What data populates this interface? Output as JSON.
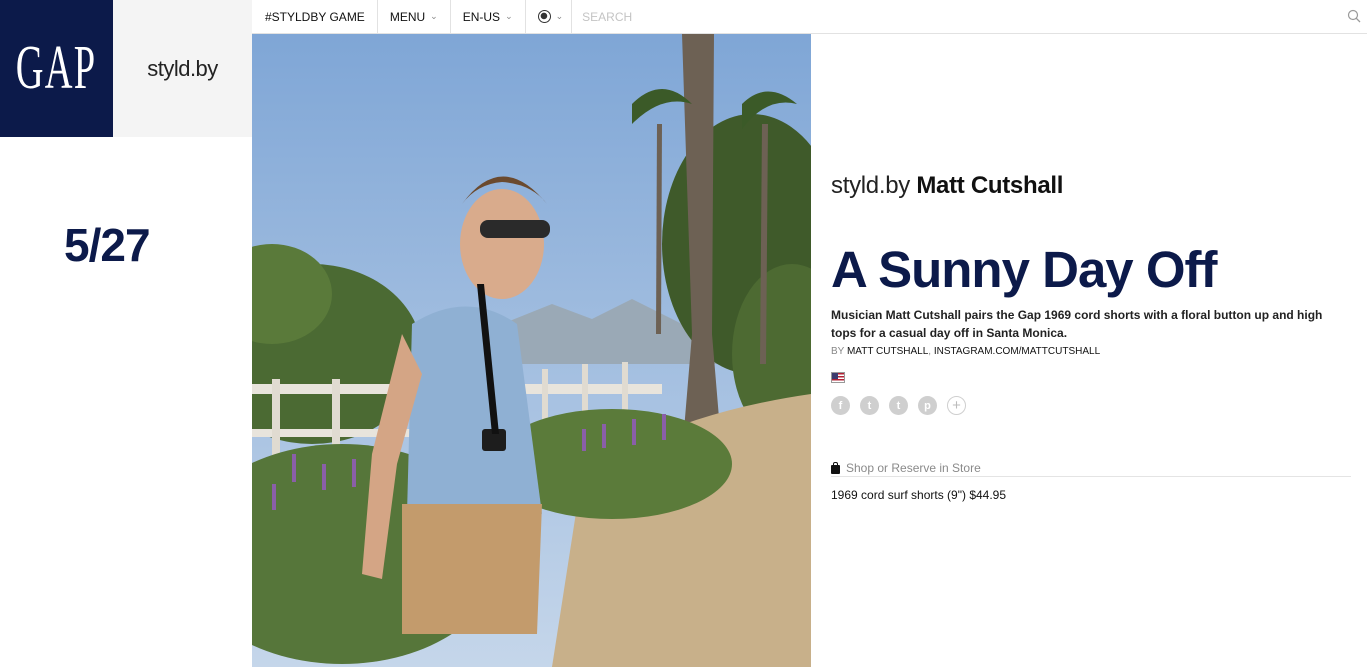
{
  "brand": {
    "logo_text": "GAP",
    "site_name": "styld.by",
    "logo_bg_color": "#0c1a4a"
  },
  "date": "5/27",
  "nav": {
    "game_label": "#STYLDBY GAME",
    "menu_label": "MENU",
    "locale_label": "EN-US",
    "globe_icon": "globe-icon",
    "search_placeholder": "SEARCH",
    "search_icon": "search-icon"
  },
  "article": {
    "byline_prefix": "styld.by",
    "byline_name": "Matt Cutshall",
    "headline": "A Sunny Day Off",
    "description": "Musician Matt Cutshall pairs the Gap 1969 cord shorts with a floral button up and high tops for a casual day off in Santa Monica.",
    "credit_prefix": "BY",
    "credit_author": "MATT CUTSHALL",
    "credit_link": "INSTAGRAM.COM/MATTCUTSHALL",
    "flag_icon": "us-flag-icon",
    "social": [
      {
        "name": "facebook-icon",
        "glyph": "f"
      },
      {
        "name": "twitter-icon",
        "glyph": "t"
      },
      {
        "name": "tumblr-icon",
        "glyph": "t"
      },
      {
        "name": "pinterest-icon",
        "glyph": "p"
      },
      {
        "name": "more-share-icon",
        "glyph": "+"
      }
    ],
    "shop_label": "Shop or Reserve in Store",
    "product_label": "1969 cord surf shorts (9\") $44.95"
  }
}
